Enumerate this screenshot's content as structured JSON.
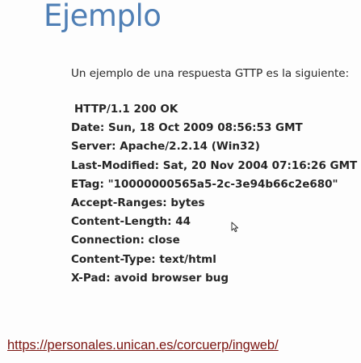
{
  "slide": {
    "title": "Ejemplo",
    "intro": "Un ejemplo de una respuesta GTTP es la siguiente:",
    "http_response": [
      "HTTP/1.1 200 OK",
      "Date: Sun, 18 Oct 2009 08:56:53 GMT",
      "Server: Apache/2.2.14 (Win32)",
      "Last-Modified: Sat, 20 Nov 2004 07:16:26 GMT",
      "ETag: \"10000000565a5-2c-3e94b66c2e680\"",
      "Accept-Ranges: bytes",
      "Content-Length: 44",
      "Connection: close",
      "Content-Type: text/html",
      "X-Pad: avoid browser bug"
    ],
    "url": "https://personales.unican.es/corcuerp/ingweb/"
  },
  "colors": {
    "title": "#4f7fb5",
    "body_text": "#262626",
    "link": "#7a1410",
    "background": "#fdfdfd"
  },
  "icons": {
    "cursor": "mouse-pointer-icon"
  }
}
